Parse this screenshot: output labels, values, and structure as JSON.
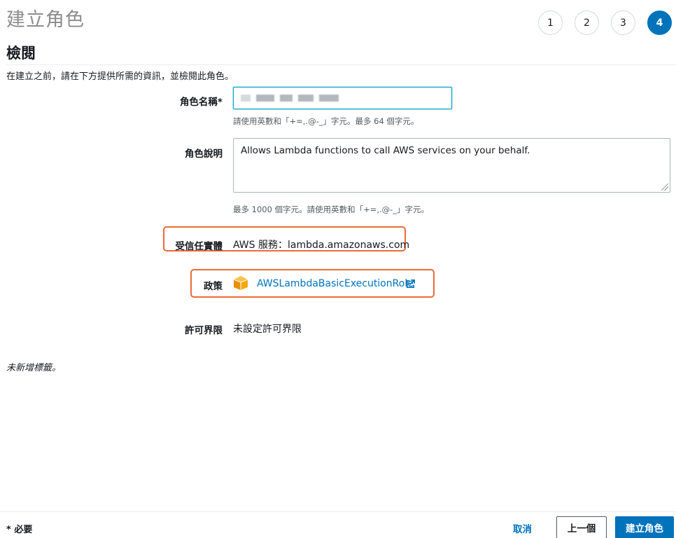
{
  "header": {
    "title": "建立角色",
    "steps": [
      {
        "label": "1",
        "active": false
      },
      {
        "label": "2",
        "active": false
      },
      {
        "label": "3",
        "active": false
      },
      {
        "label": "4",
        "active": true
      }
    ]
  },
  "review": {
    "section_title": "檢閱",
    "intro": "在建立之前，請在下方提供所需的資訊，並檢閱此角色。"
  },
  "role_name": {
    "label": "角色名稱*",
    "value": "",
    "value_redacted": true,
    "hint": "請使用英數和「+=,.@-_」字元。最多 64 個字元。"
  },
  "role_description": {
    "label": "角色說明",
    "value": "Allows Lambda functions to call AWS services on your behalf.",
    "hint": "最多 1000 個字元。請使用英數和「+=,.@-_」字元。"
  },
  "trusted_entities": {
    "label": "受信任實體",
    "value": "AWS 服務：lambda.amazonaws.com"
  },
  "policies": {
    "label": "政策",
    "items": [
      {
        "name": "AWSLambdaBasicExecutionRole",
        "icon": "aws-managed-policy-icon"
      }
    ]
  },
  "permissions_boundary": {
    "label": "許可界限",
    "value": "未設定許可界限"
  },
  "tags": {
    "empty_text": "未新增標籤。"
  },
  "footer": {
    "required_note": "* 必要",
    "cancel_label": "取消",
    "previous_label": "上一個",
    "create_label": "建立角色"
  },
  "colors": {
    "primary": "#0073bb",
    "highlight_border": "#ea6b3a",
    "policy_icon": "#f7a80d"
  }
}
